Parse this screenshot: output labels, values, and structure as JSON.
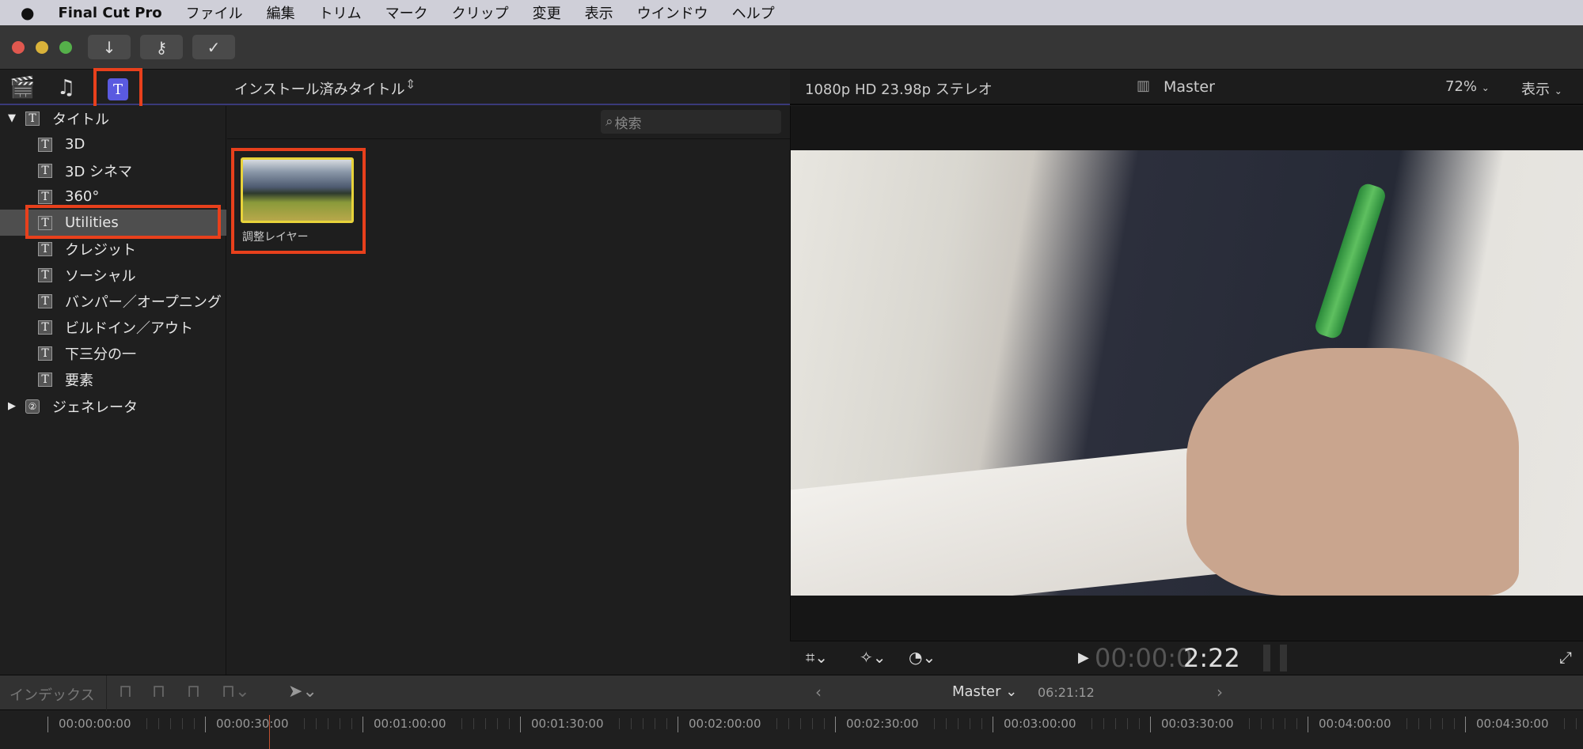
{
  "menubar": {
    "app": "Final Cut Pro",
    "items": [
      "ファイル",
      "編集",
      "トリム",
      "マーク",
      "クリップ",
      "変更",
      "表示",
      "ウインドウ",
      "ヘルプ"
    ]
  },
  "browser": {
    "title": "インストール済みタイトル",
    "search_placeholder": "検索",
    "sidebar": {
      "root": "タイトル",
      "items": [
        "3D",
        "3D シネマ",
        "360°",
        "Utilities",
        "クレジット",
        "ソーシャル",
        "バンパー／オープニング",
        "ビルドイン／アウト",
        "下三分の一",
        "要素"
      ],
      "selected": "Utilities",
      "generators": "ジェネレータ"
    },
    "clips": [
      {
        "name": "調整レイヤー"
      }
    ]
  },
  "viewer": {
    "format": "1080p HD 23.98p ステレオ",
    "project": "Master",
    "zoom": "72%",
    "view_menu": "表示",
    "timecode_dim": "00:00:0",
    "timecode_bright": "2:22"
  },
  "timeline": {
    "index_label": "インデックス",
    "project": "Master",
    "duration": "06:21:12",
    "ruler": [
      "00:00:00:00",
      "00:00:30:00",
      "00:01:00:00",
      "00:01:30:00",
      "00:02:00:00",
      "00:02:30:00",
      "00:03:00:00",
      "00:03:30:00",
      "00:04:00:00",
      "00:04:30:00"
    ]
  },
  "colors": {
    "highlight": "#e8401c",
    "accent": "#5a5ae0"
  }
}
